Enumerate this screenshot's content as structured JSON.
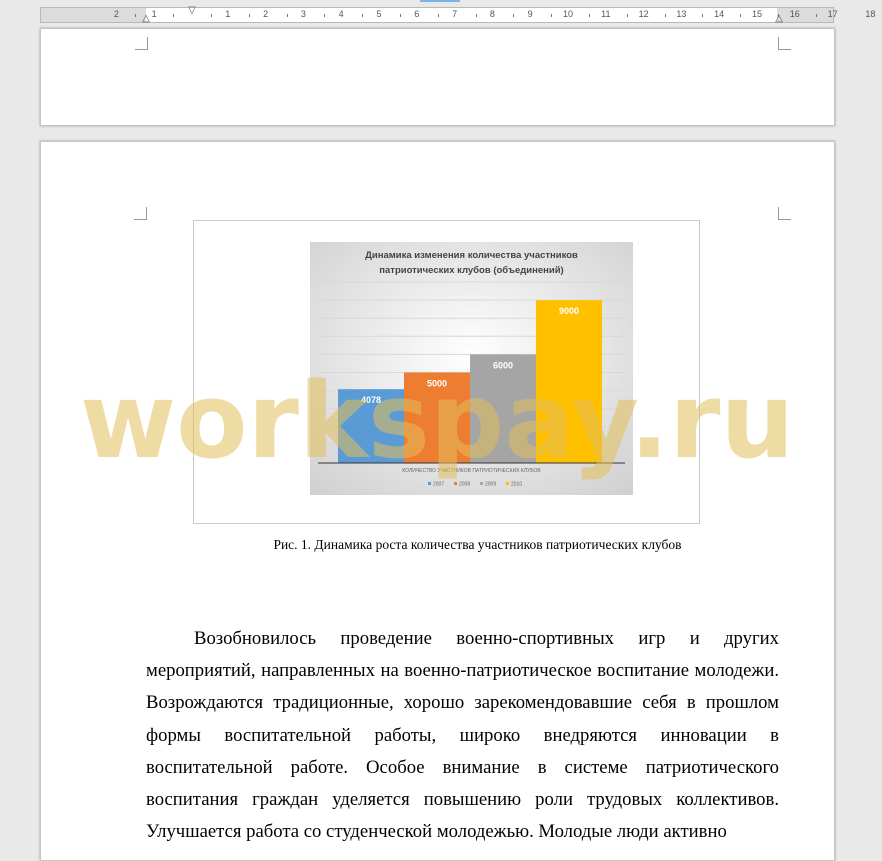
{
  "ruler": {
    "left_numbers": [
      "2",
      "1"
    ],
    "right_numbers": [
      "1",
      "2",
      "3",
      "4",
      "5",
      "6",
      "7",
      "8",
      "9",
      "10",
      "11",
      "12",
      "13",
      "14",
      "15",
      "16",
      "17",
      "18"
    ]
  },
  "watermark": "workspay.ru",
  "figure": {
    "caption": "Рис. 1. Динамика роста количества участников патриотических клубов"
  },
  "chart_data": {
    "type": "bar",
    "title": "Динамика изменения количества участников патриотических клубов (объединений)",
    "xlabel": "КОЛИЧЕСТВО УЧАСТНИКОВ ПАТРИОТИЧЕСКИХ КЛУБОВ",
    "ylabel": "",
    "ylim": [
      0,
      10000
    ],
    "grid": true,
    "legend_position": "bottom",
    "series": [
      {
        "name": "2007",
        "value": 4078,
        "color": "#5b9bd5"
      },
      {
        "name": "2008",
        "value": 5000,
        "color": "#ed7d31"
      },
      {
        "name": "2009",
        "value": 6000,
        "color": "#a5a5a5"
      },
      {
        "name": "2010",
        "value": 9000,
        "color": "#ffc000"
      }
    ]
  },
  "body_text": "Возобновилось проведение военно-спортивных игр и других мероприятий, направленных на военно-патриотическое воспитание молодежи. Возрождаются традиционные, хорошо зарекомендовавшие себя в прошлом формы воспитательной работы, широко внедряются инновации в воспитательной работе. Особое внимание в системе патриотического воспитания граждан уделяется повышению роли трудовых коллективов. Улучшается работа со студенческой молодежью. Молодые люди активно"
}
